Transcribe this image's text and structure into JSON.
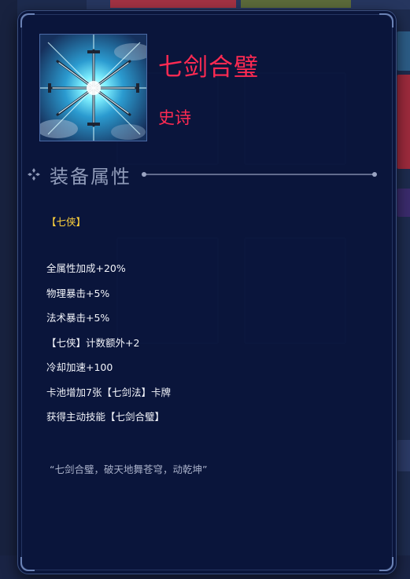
{
  "item": {
    "name": "七剑合璧",
    "rarity": "史诗",
    "image_icon": "crossed-swords-radiant-art"
  },
  "section": {
    "title": "装备属性",
    "icon": "diamond-ornament-icon"
  },
  "tag": "【七侠】",
  "attributes": [
    "全属性加成+20%",
    "物理暴击+5%",
    "法术暴击+5%",
    "【七侠】计数额外+2",
    "冷却加速+100",
    "卡池增加7张【七剑法】卡牌",
    "获得主动技能【七剑合璧】"
  ],
  "flavor_text": "“七剑合璧，破天地舞苍穹，动乾坤”",
  "colors": {
    "name": "#ff2a52",
    "rarity": "#ff2a52",
    "tag": "#ffd23c",
    "attribute": "#f2f4fa",
    "flavor": "#a9b1c9",
    "section_title": "#8f9ab8",
    "panel_bg": "#0a143a",
    "panel_border": "#3b4f7e"
  }
}
